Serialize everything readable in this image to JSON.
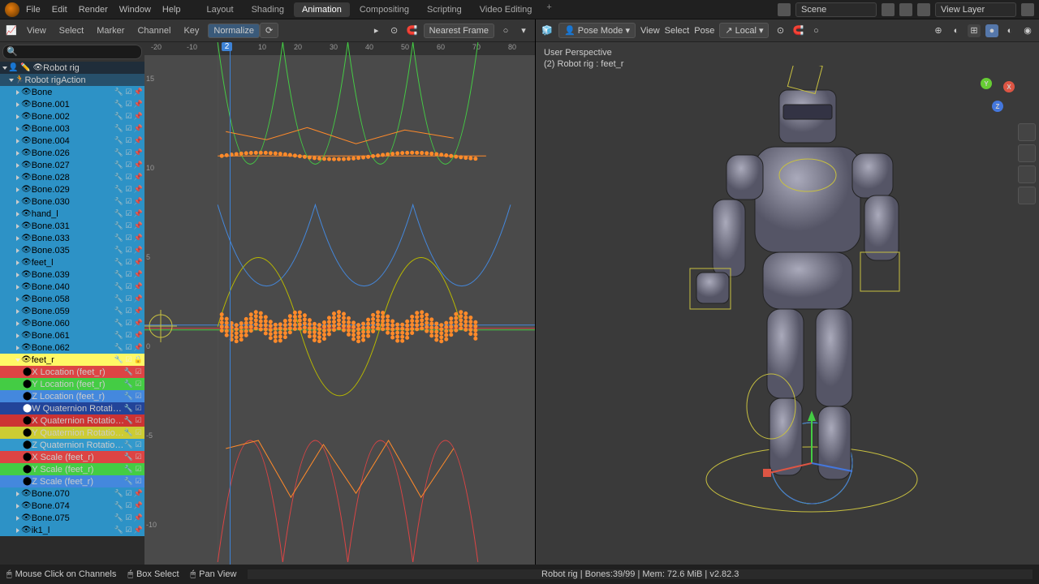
{
  "top_menu": [
    "File",
    "Edit",
    "Render",
    "Window",
    "Help"
  ],
  "workspaces": [
    "Layout",
    "Shading",
    "Animation",
    "Compositing",
    "Scripting",
    "Video Editing"
  ],
  "active_workspace": "Animation",
  "scene_name": "Scene",
  "view_layer": "View Layer",
  "graph_editor": {
    "menus": [
      "View",
      "Select",
      "Marker",
      "Channel",
      "Key"
    ],
    "normalize": "Normalize",
    "snap": "Nearest Frame",
    "current_frame": "2",
    "ruler": [
      -20,
      -10,
      0,
      10,
      20,
      30,
      40,
      50,
      60,
      70,
      80
    ],
    "y_ticks": [
      15,
      10,
      5,
      0,
      -5,
      -10
    ]
  },
  "channels": {
    "search_placeholder": "",
    "root": "Robot rig",
    "action": "Robot rigAction",
    "bones": [
      "Bone",
      "Bone.001",
      "Bone.002",
      "Bone.003",
      "Bone.004",
      "Bone.026",
      "Bone.027",
      "Bone.028",
      "Bone.029",
      "Bone.030",
      "hand_l",
      "Bone.031",
      "Bone.033",
      "Bone.035",
      "feet_l",
      "Bone.039",
      "Bone.040",
      "Bone.058",
      "Bone.059",
      "Bone.060",
      "Bone.061",
      "Bone.062"
    ],
    "selected": "feet_r",
    "fcurves": [
      {
        "label": "X Location (feet_r)",
        "cls": "ch-xloc"
      },
      {
        "label": "Y Location (feet_r)",
        "cls": "ch-yloc"
      },
      {
        "label": "Z Location (feet_r)",
        "cls": "ch-zloc"
      },
      {
        "label": "W Quaternion Rotation (feet_r)",
        "cls": "ch-wq"
      },
      {
        "label": "X Quaternion Rotation (feet_r)",
        "cls": "ch-xq"
      },
      {
        "label": "Y Quaternion Rotation (feet_r)",
        "cls": "ch-yq"
      },
      {
        "label": "Z Quaternion Rotation (feet_r)",
        "cls": "ch-zq"
      },
      {
        "label": "X Scale (feet_r)",
        "cls": "ch-sx"
      },
      {
        "label": "Y Scale (feet_r)",
        "cls": "ch-sy"
      },
      {
        "label": "Z Scale (feet_r)",
        "cls": "ch-sz"
      }
    ],
    "bones_after": [
      "Bone.070",
      "Bone.074",
      "Bone.075",
      "ik1_l"
    ]
  },
  "viewport": {
    "menus": [
      "View",
      "Select",
      "Pose"
    ],
    "mode": "Pose Mode",
    "orientation": "Local",
    "info_line1": "User Perspective",
    "info_line2": "(2) Robot rig : feet_r"
  },
  "status": {
    "hint1": "Mouse Click on Channels",
    "hint2": "Box Select",
    "hint3": "Pan View",
    "right": "Robot rig | Bones:39/99 | Mem: 72.6 MiB | v2.82.3"
  }
}
